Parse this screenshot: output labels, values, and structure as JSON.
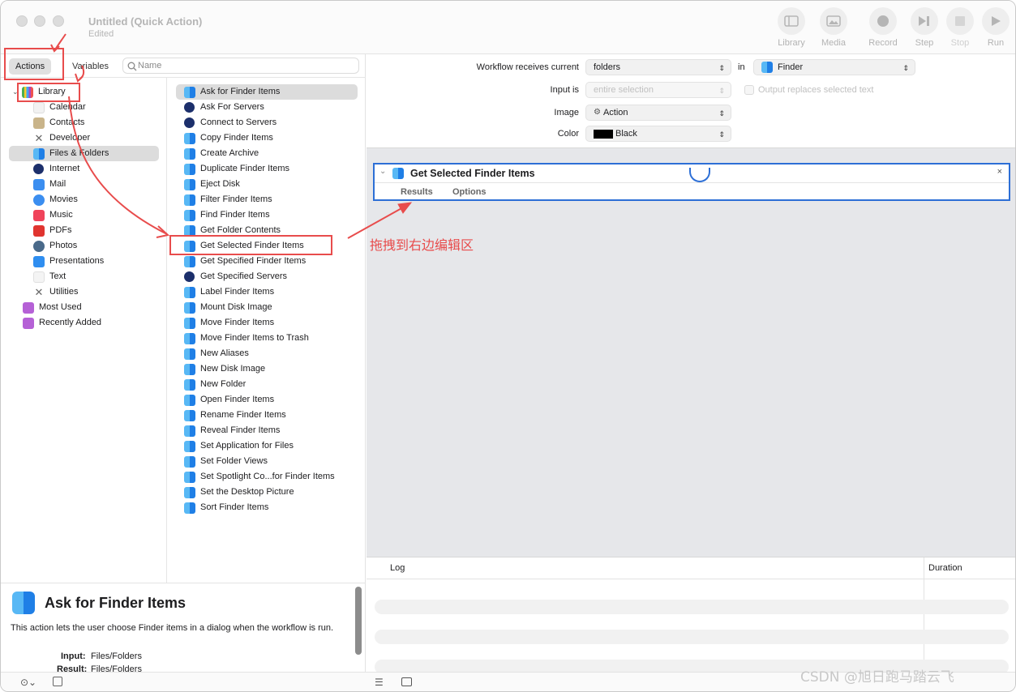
{
  "window": {
    "title": "Untitled (Quick Action)",
    "subtitle": "Edited"
  },
  "toolbar": {
    "library": "Library",
    "media": "Media",
    "record": "Record",
    "step": "Step",
    "stop": "Stop",
    "run": "Run"
  },
  "tabs": {
    "actions": "Actions",
    "variables": "Variables"
  },
  "search": {
    "placeholder": "Name"
  },
  "library": {
    "root": "Library",
    "items": [
      "Calendar",
      "Contacts",
      "Developer",
      "Files & Folders",
      "Internet",
      "Mail",
      "Movies",
      "Music",
      "PDFs",
      "Photos",
      "Presentations",
      "Text",
      "Utilities"
    ],
    "most_used": "Most Used",
    "recently_added": "Recently Added"
  },
  "actions": [
    "Ask for Finder Items",
    "Ask For Servers",
    "Connect to Servers",
    "Copy Finder Items",
    "Create Archive",
    "Duplicate Finder Items",
    "Eject Disk",
    "Filter Finder Items",
    "Find Finder Items",
    "Get Folder Contents",
    "Get Selected Finder Items",
    "Get Specified Finder Items",
    "Get Specified Servers",
    "Label Finder Items",
    "Mount Disk Image",
    "Move Finder Items",
    "Move Finder Items to Trash",
    "New Aliases",
    "New Disk Image",
    "New Folder",
    "Open Finder Items",
    "Rename Finder Items",
    "Reveal Finder Items",
    "Set Application for Files",
    "Set Folder Views",
    "Set Spotlight Co...for Finder Items",
    "Set the Desktop Picture",
    "Sort Finder Items"
  ],
  "description": {
    "title": "Ask for Finder Items",
    "text": "This action lets the user choose Finder items in a dialog when the workflow is run.",
    "input_label": "Input:",
    "input_value": "Files/Folders",
    "result_label": "Result:",
    "result_value": "Files/Folders"
  },
  "workflow": {
    "receives_label": "Workflow receives current",
    "receives_value": "folders",
    "in_label": "in",
    "in_value": "Finder",
    "input_is_label": "Input is",
    "input_is_value": "entire selection",
    "output_replaces": "Output replaces selected text",
    "image_label": "Image",
    "image_value": "Action",
    "color_label": "Color",
    "color_value": "Black"
  },
  "action_card": {
    "title": "Get Selected Finder Items",
    "tab_results": "Results",
    "tab_options": "Options"
  },
  "annotation": "拖拽到右边编辑区",
  "log": {
    "log_label": "Log",
    "duration_label": "Duration"
  },
  "watermark": "CSDN @旭日跑马踏云飞",
  "colors": {
    "accent": "#2d6fd6",
    "annotation": "#e84c4c"
  }
}
